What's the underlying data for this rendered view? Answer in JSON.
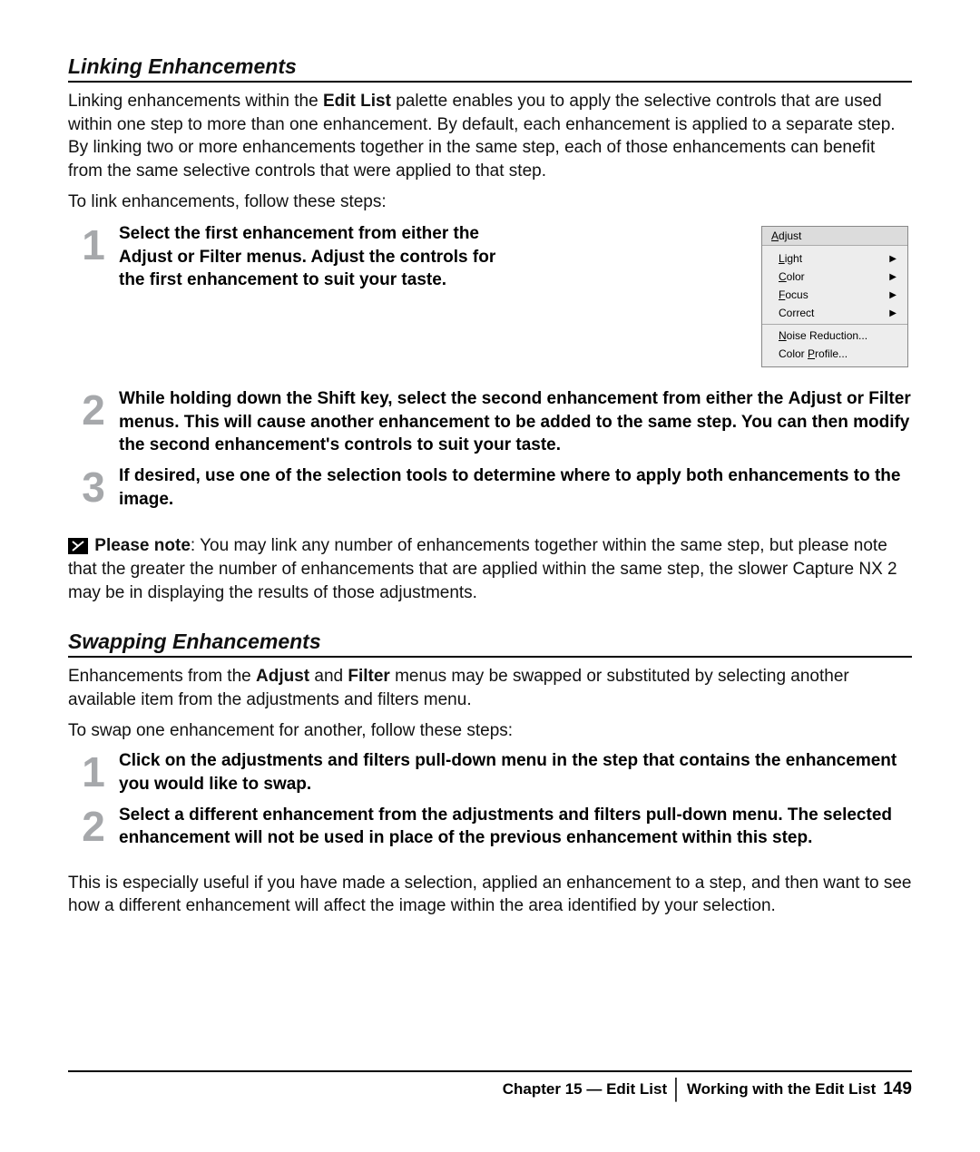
{
  "section1": {
    "heading": "Linking Enhancements",
    "para1_parts": {
      "a": "Linking enhancements within the ",
      "b": "Edit List",
      "c": " palette enables you to apply the selective controls that are used within one step to more than one enhancement. By default, each enhancement is applied to a separate step. By linking two or more enhancements together in the same step, each of those enhancements can benefit from the same selective controls that were applied to that step."
    },
    "para2": "To link enhancements, follow these steps:",
    "steps": {
      "1": {
        "num": "1",
        "a": "Select the first enhancement from either the ",
        "b": "Adjust",
        "c": " or ",
        "d": "Filter",
        "e": " menus. Adjust the controls for the first enhancement to suit your taste."
      },
      "2": {
        "num": "2",
        "a": "While holding down the Shift key, select the second enhancement from either the ",
        "b": "Adjust",
        "c": " or ",
        "d": "Filter",
        "e": " menus. This will cause another enhancement to be added to the same step. You can then modify the second enhancement's controls to suit your taste."
      },
      "3": {
        "num": "3",
        "a": "If desired, use one of the selection tools to determine where to apply both enhancements to the image."
      }
    },
    "note": {
      "label": "Please note",
      "text": ": You may link any number of enhancements together within the same step, but please note that the greater the number of enhancements that are applied within the same step, the slower Capture NX 2 may be in displaying the results of those adjustments."
    }
  },
  "menu": {
    "header_u": "A",
    "header_rest": "djust",
    "items": [
      {
        "u": "L",
        "rest": "ight",
        "sub": true
      },
      {
        "u": "C",
        "rest": "olor",
        "sub": true
      },
      {
        "u": "F",
        "rest": "ocus",
        "sub": true
      },
      {
        "u": "",
        "rest": "Correct",
        "sub": true
      }
    ],
    "items2": [
      {
        "u": "N",
        "rest": "oise Reduction..."
      },
      {
        "pre": "Color ",
        "u": "P",
        "rest": "rofile..."
      }
    ]
  },
  "section2": {
    "heading": "Swapping Enhancements",
    "para1_parts": {
      "a": "Enhancements from the ",
      "b": "Adjust",
      "c": " and ",
      "d": "Filter",
      "e": " menus may be swapped or substituted by selecting another available item from the adjustments and filters menu."
    },
    "para2": "To swap one enhancement for another, follow these steps:",
    "steps": {
      "1": {
        "num": "1",
        "a": "Click on the adjustments and filters pull-down menu in the step that contains the enhancement you would like to swap."
      },
      "2": {
        "num": "2",
        "a": "Select a different enhancement from the adjustments and filters pull-down menu. The selected enhancement will not be used in place of the previous enhancement within this step."
      }
    },
    "para3": "This is especially useful if you have made a selection, applied an enhancement to a step, and then want to see how a different enhancement will affect the image within the area identified by your selection."
  },
  "footer": {
    "chapter": "Chapter 15 — Edit List",
    "sub": "Working with the Edit List",
    "page": "149"
  }
}
